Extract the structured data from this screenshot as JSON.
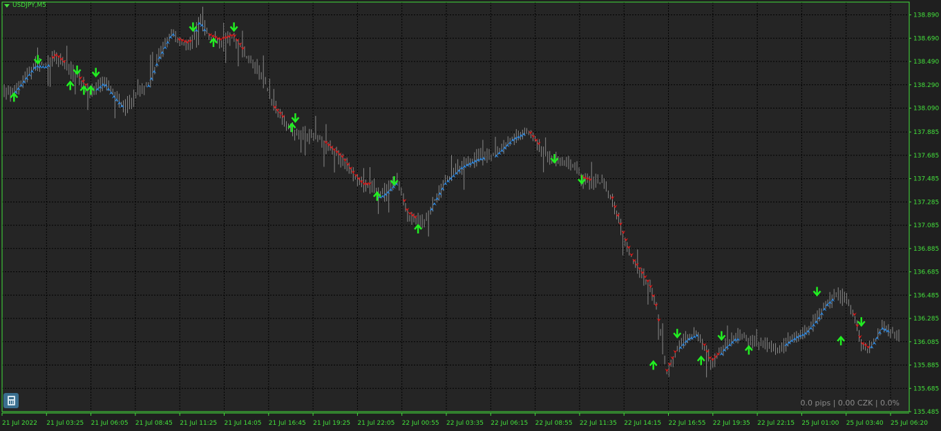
{
  "window": {
    "symbol_label": "USDJPY,M5",
    "stats_text": "0.0 pips | 0.00 CZK | 0.0%"
  },
  "colors": {
    "background": "#252525",
    "frame": "#44e23c",
    "grid": "#000000",
    "candle": "#8a8a8a",
    "uptrend_marker": "#2e8be6",
    "downtrend_marker": "#e01818",
    "signal_arrow": "#22ee22",
    "axis_text": "#44e23c"
  },
  "icons": {
    "calculator": "calculator-icon",
    "symbol_menu": "triangle-down-icon"
  },
  "chart_data": {
    "type": "candlestick",
    "symbol": "USDJPY",
    "timeframe": "M5",
    "ylim": [
      135.485,
      139.0
    ],
    "y_ticks": [
      "138.890",
      "138.690",
      "138.490",
      "138.290",
      "138.090",
      "137.885",
      "137.685",
      "137.485",
      "137.285",
      "137.085",
      "136.885",
      "136.685",
      "136.485",
      "136.285",
      "136.085",
      "135.885",
      "135.685",
      "135.485"
    ],
    "x_ticks": [
      "21 Jul 2022",
      "21 Jul 03:25",
      "21 Jul 06:05",
      "21 Jul 08:45",
      "21 Jul 11:25",
      "21 Jul 14:05",
      "21 Jul 16:45",
      "21 Jul 19:25",
      "21 Jul 22:05",
      "22 Jul 00:55",
      "22 Jul 03:35",
      "22 Jul 06:15",
      "22 Jul 08:55",
      "22 Jul 11:35",
      "22 Jul 14:15",
      "22 Jul 16:55",
      "22 Jul 19:35",
      "22 Jul 22:15",
      "25 Jul 01:00",
      "25 Jul 03:40",
      "25 Jul 06:20"
    ],
    "price_path": [
      [
        0,
        138.24
      ],
      [
        0.3,
        138.21
      ],
      [
        0.6,
        138.32
      ],
      [
        1.0,
        138.47
      ],
      [
        1.3,
        138.46
      ],
      [
        1.6,
        138.53
      ],
      [
        2.0,
        138.42
      ],
      [
        2.3,
        138.33
      ],
      [
        2.6,
        138.22
      ],
      [
        3.0,
        138.32
      ],
      [
        3.3,
        138.2
      ],
      [
        3.6,
        138.1
      ],
      [
        4.0,
        138.22
      ],
      [
        4.3,
        138.3
      ],
      [
        4.6,
        138.53
      ],
      [
        5.0,
        138.75
      ],
      [
        5.2,
        138.66
      ],
      [
        5.5,
        138.63
      ],
      [
        5.8,
        138.85
      ],
      [
        6.1,
        138.7
      ],
      [
        6.4,
        138.66
      ],
      [
        6.8,
        138.7
      ],
      [
        7.2,
        138.52
      ],
      [
        7.6,
        138.39
      ],
      [
        8.0,
        138.08
      ],
      [
        8.3,
        137.98
      ],
      [
        8.6,
        137.88
      ],
      [
        9.0,
        137.86
      ],
      [
        9.3,
        137.83
      ],
      [
        9.6,
        137.75
      ],
      [
        10.0,
        137.65
      ],
      [
        10.3,
        137.52
      ],
      [
        10.6,
        137.42
      ],
      [
        10.9,
        137.42
      ],
      [
        11.1,
        137.34
      ],
      [
        11.3,
        137.38
      ],
      [
        11.6,
        137.47
      ],
      [
        11.9,
        137.18
      ],
      [
        12.2,
        137.12
      ],
      [
        12.4,
        137.12
      ],
      [
        12.7,
        137.3
      ],
      [
        13.0,
        137.46
      ],
      [
        13.5,
        137.6
      ],
      [
        14.0,
        137.67
      ],
      [
        14.5,
        137.7
      ],
      [
        15.0,
        137.84
      ],
      [
        15.4,
        137.9
      ],
      [
        15.7,
        137.78
      ],
      [
        16.0,
        137.68
      ],
      [
        16.3,
        137.64
      ],
      [
        16.5,
        137.62
      ],
      [
        16.8,
        137.6
      ],
      [
        17.0,
        137.48
      ],
      [
        17.3,
        137.45
      ],
      [
        17.6,
        137.45
      ],
      [
        17.9,
        137.3
      ],
      [
        18.2,
        137.02
      ],
      [
        18.5,
        136.78
      ],
      [
        18.8,
        136.65
      ],
      [
        19.0,
        136.56
      ],
      [
        19.2,
        136.36
      ],
      [
        19.5,
        135.82
      ],
      [
        19.8,
        136.02
      ],
      [
        20.1,
        136.12
      ],
      [
        20.4,
        136.16
      ],
      [
        20.6,
        136.04
      ],
      [
        20.8,
        135.9
      ],
      [
        21.0,
        135.96
      ],
      [
        21.2,
        136.04
      ],
      [
        21.5,
        136.12
      ],
      [
        21.8,
        136.14
      ],
      [
        22.0,
        136.08
      ],
      [
        22.3,
        136.06
      ],
      [
        22.6,
        136.04
      ],
      [
        22.8,
        136.02
      ],
      [
        23.0,
        136.08
      ],
      [
        23.3,
        136.14
      ],
      [
        23.6,
        136.18
      ],
      [
        23.9,
        136.28
      ],
      [
        24.2,
        136.42
      ],
      [
        24.5,
        136.5
      ],
      [
        24.8,
        136.44
      ],
      [
        25.0,
        136.3
      ],
      [
        25.2,
        136.06
      ],
      [
        25.4,
        136.02
      ],
      [
        25.6,
        136.1
      ],
      [
        25.8,
        136.22
      ],
      [
        26.1,
        136.18
      ],
      [
        26.3,
        136.14
      ]
    ],
    "trend_segments": [
      {
        "trend": "up",
        "from": 0.4,
        "to": 1.4
      },
      {
        "trend": "down",
        "from": 1.5,
        "to": 1.9
      },
      {
        "trend": "down",
        "from": 2.3,
        "to": 2.5
      },
      {
        "trend": "up",
        "from": 2.8,
        "to": 3.6
      },
      {
        "trend": "up",
        "from": 4.3,
        "to": 5.1
      },
      {
        "trend": "down",
        "from": 5.2,
        "to": 5.6
      },
      {
        "trend": "up",
        "from": 5.7,
        "to": 5.95
      },
      {
        "trend": "down",
        "from": 6.1,
        "to": 7.1
      },
      {
        "trend": "down",
        "from": 8.0,
        "to": 8.3
      },
      {
        "trend": "down",
        "from": 9.5,
        "to": 10.8
      },
      {
        "trend": "up",
        "from": 11.0,
        "to": 11.6
      },
      {
        "trend": "down",
        "from": 11.8,
        "to": 12.2
      },
      {
        "trend": "up",
        "from": 12.6,
        "to": 14.2
      },
      {
        "trend": "up",
        "from": 14.5,
        "to": 15.3
      },
      {
        "trend": "down",
        "from": 15.5,
        "to": 15.8
      },
      {
        "trend": "down",
        "from": 17.0,
        "to": 17.3
      },
      {
        "trend": "down",
        "from": 17.9,
        "to": 19.3
      },
      {
        "trend": "down",
        "from": 19.5,
        "to": 19.8
      },
      {
        "trend": "up",
        "from": 19.9,
        "to": 20.4
      },
      {
        "trend": "down",
        "from": 20.6,
        "to": 21.0
      },
      {
        "trend": "up",
        "from": 21.1,
        "to": 21.6
      },
      {
        "trend": "up",
        "from": 23.0,
        "to": 24.4
      },
      {
        "trend": "down",
        "from": 25.0,
        "to": 25.4
      },
      {
        "trend": "up",
        "from": 25.5,
        "to": 26.0
      }
    ],
    "signals": [
      {
        "t": 0.35,
        "price": 138.18,
        "dir": "up"
      },
      {
        "t": 1.05,
        "price": 138.51,
        "dir": "down"
      },
      {
        "t": 2.0,
        "price": 138.28,
        "dir": "up"
      },
      {
        "t": 2.2,
        "price": 138.42,
        "dir": "down"
      },
      {
        "t": 2.4,
        "price": 138.24,
        "dir": "up"
      },
      {
        "t": 2.6,
        "price": 138.24,
        "dir": "up"
      },
      {
        "t": 2.75,
        "price": 138.4,
        "dir": "down"
      },
      {
        "t": 5.6,
        "price": 138.79,
        "dir": "down"
      },
      {
        "t": 6.2,
        "price": 138.65,
        "dir": "up"
      },
      {
        "t": 6.8,
        "price": 138.79,
        "dir": "down"
      },
      {
        "t": 8.5,
        "price": 137.92,
        "dir": "up"
      },
      {
        "t": 8.6,
        "price": 138.01,
        "dir": "down"
      },
      {
        "t": 11.0,
        "price": 137.33,
        "dir": "up"
      },
      {
        "t": 11.5,
        "price": 137.47,
        "dir": "down"
      },
      {
        "t": 12.2,
        "price": 137.05,
        "dir": "up"
      },
      {
        "t": 16.2,
        "price": 137.66,
        "dir": "down"
      },
      {
        "t": 17.0,
        "price": 137.48,
        "dir": "down"
      },
      {
        "t": 19.1,
        "price": 135.88,
        "dir": "up"
      },
      {
        "t": 19.8,
        "price": 136.16,
        "dir": "down"
      },
      {
        "t": 20.5,
        "price": 135.92,
        "dir": "up"
      },
      {
        "t": 21.1,
        "price": 136.14,
        "dir": "down"
      },
      {
        "t": 21.9,
        "price": 136.01,
        "dir": "up"
      },
      {
        "t": 23.9,
        "price": 136.52,
        "dir": "down"
      },
      {
        "t": 24.6,
        "price": 136.09,
        "dir": "up"
      },
      {
        "t": 25.2,
        "price": 136.26,
        "dir": "down"
      }
    ]
  }
}
